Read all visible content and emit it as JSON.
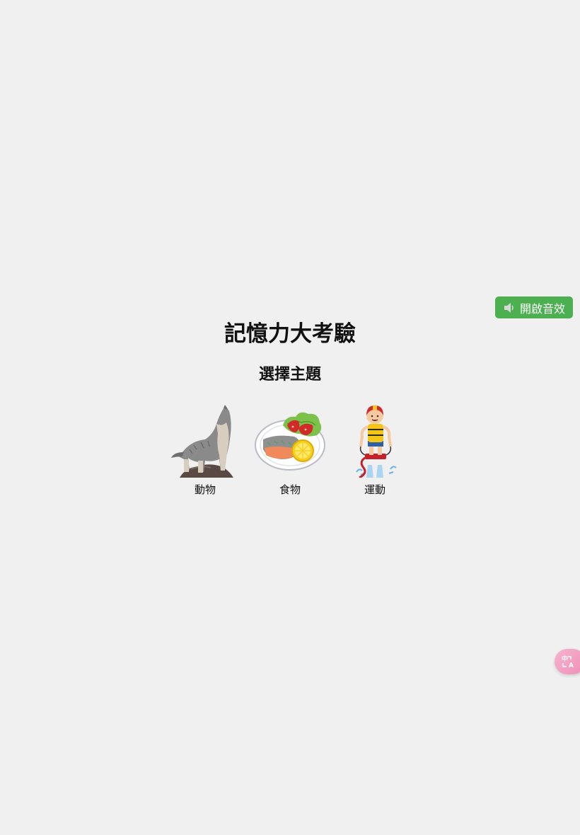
{
  "sound_button": {
    "label": "開啟音效",
    "icon": "speaker-icon",
    "color": "#4caf50"
  },
  "title": "記憶力大考驗",
  "subtitle": "選擇主題",
  "themes": [
    {
      "label": "動物",
      "icon": "wolf-illustration"
    },
    {
      "label": "食物",
      "icon": "salmon-plate-illustration"
    },
    {
      "label": "運動",
      "icon": "flyboard-rider-illustration"
    }
  ],
  "translate_button": {
    "icon": "translate-icon",
    "color": "#ef8fb7"
  },
  "colors": {
    "background": "#f0f0f0",
    "accent": "#4caf50"
  }
}
